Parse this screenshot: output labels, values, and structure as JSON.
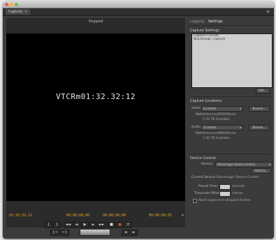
{
  "window": {
    "tab_label": "Capture",
    "tab_close": "×",
    "panel_menu": "≡"
  },
  "monitor": {
    "header": "Stopped",
    "overlay_timecode": "VTCRm01:32.32:12",
    "timecodes": {
      "current": "01;32;32;12",
      "in": "00;00;00;00",
      "out": "00;00;00;00",
      "duration": "00;00;00;01"
    },
    "transport": {
      "row1": [
        "{",
        "}",
        "◄◄",
        "◄",
        "▶",
        "►",
        "►►",
        "■",
        "●",
        "⟳"
      ],
      "row2": [
        "{→",
        "←}"
      ]
    }
  },
  "right_panel": {
    "tabs": [
      "Logging",
      "Settings"
    ],
    "capture_settings": {
      "title": "Capture Settings",
      "format_lines": [
        "Capture Format:",
        "Blackmagic Capture"
      ],
      "edit_button": "Edit..."
    },
    "capture_locations": {
      "title": "Capture Locations",
      "video_label": "Video:",
      "video_value": "[Custom]",
      "browse": "Browse...",
      "video_path_label": "Path:",
      "video_path": "/Volumes/BMD/Media",
      "video_free": "1.56 TB Available",
      "audio_label": "Audio:",
      "audio_value": "[Custom]",
      "audio_path_label": "Path:",
      "audio_path": "/Volumes/BMD/Media",
      "audio_free": "1.56 TB Available"
    },
    "device_control": {
      "title": "Device Control",
      "device_label": "Device:",
      "device_value": "Blackmagic Device Control",
      "options_button": "Options...",
      "status_label": "Current Device:",
      "status_value": "Blackmagic Device Control",
      "preroll_label": "Preroll Time:",
      "preroll_unit": "seconds",
      "offset_label": "Timecode Offset:",
      "offset_unit": "frames",
      "abort_label": "Abort capture on dropped frames"
    }
  }
}
